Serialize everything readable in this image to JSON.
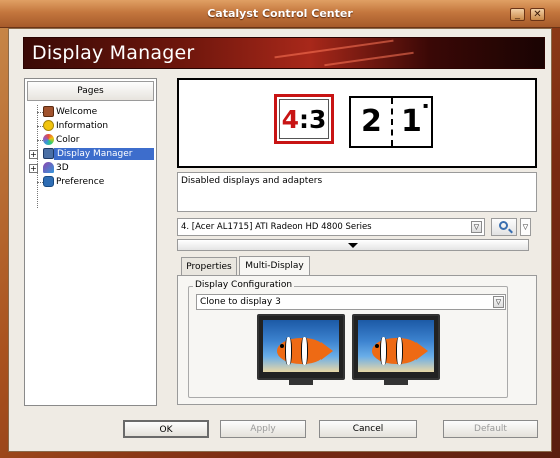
{
  "window": {
    "title": "Catalyst Control Center",
    "minimize_glyph": "_",
    "close_glyph": "✕"
  },
  "banner": {
    "title": "Display Manager"
  },
  "pages": {
    "header": "Pages",
    "items": [
      {
        "label": "Welcome",
        "icon": "welcome-icon",
        "color": "#a0522d"
      },
      {
        "label": "Information",
        "icon": "info-icon",
        "color": "#f1c40f"
      },
      {
        "label": "Color",
        "icon": "color-icon",
        "color": "#e74c3c"
      },
      {
        "label": "Display Manager",
        "icon": "display-manager-icon",
        "color": "#4a6fa5",
        "selected": true,
        "expandable": true
      },
      {
        "label": "3D",
        "icon": "3d-icon",
        "color": "#8e44ad",
        "expandable": true
      },
      {
        "label": "Preference",
        "icon": "preference-icon",
        "color": "#2e6db4"
      }
    ]
  },
  "preview": {
    "aspect_left": "4",
    "aspect_sep": ":",
    "aspect_right": "3",
    "display_left": "2",
    "display_right": "1",
    "display_mark": "▪"
  },
  "status_text": "Disabled displays and adapters",
  "adapter": {
    "value": "4.  [Acer AL1715] ATI Radeon HD 4800 Series",
    "arrow": "▽"
  },
  "tabs": [
    {
      "label": "Properties"
    },
    {
      "label": "Multi-Display",
      "active": true
    }
  ],
  "config": {
    "group_title": "Display Configuration",
    "value": "Clone to display 3",
    "arrow": "▽"
  },
  "buttons": {
    "ok": "OK",
    "apply": "Apply",
    "cancel": "Cancel",
    "default": "Default"
  },
  "colors": {
    "selection": "#3d6dcc",
    "accent_red": "#c81414",
    "banner": "#a8281a"
  }
}
